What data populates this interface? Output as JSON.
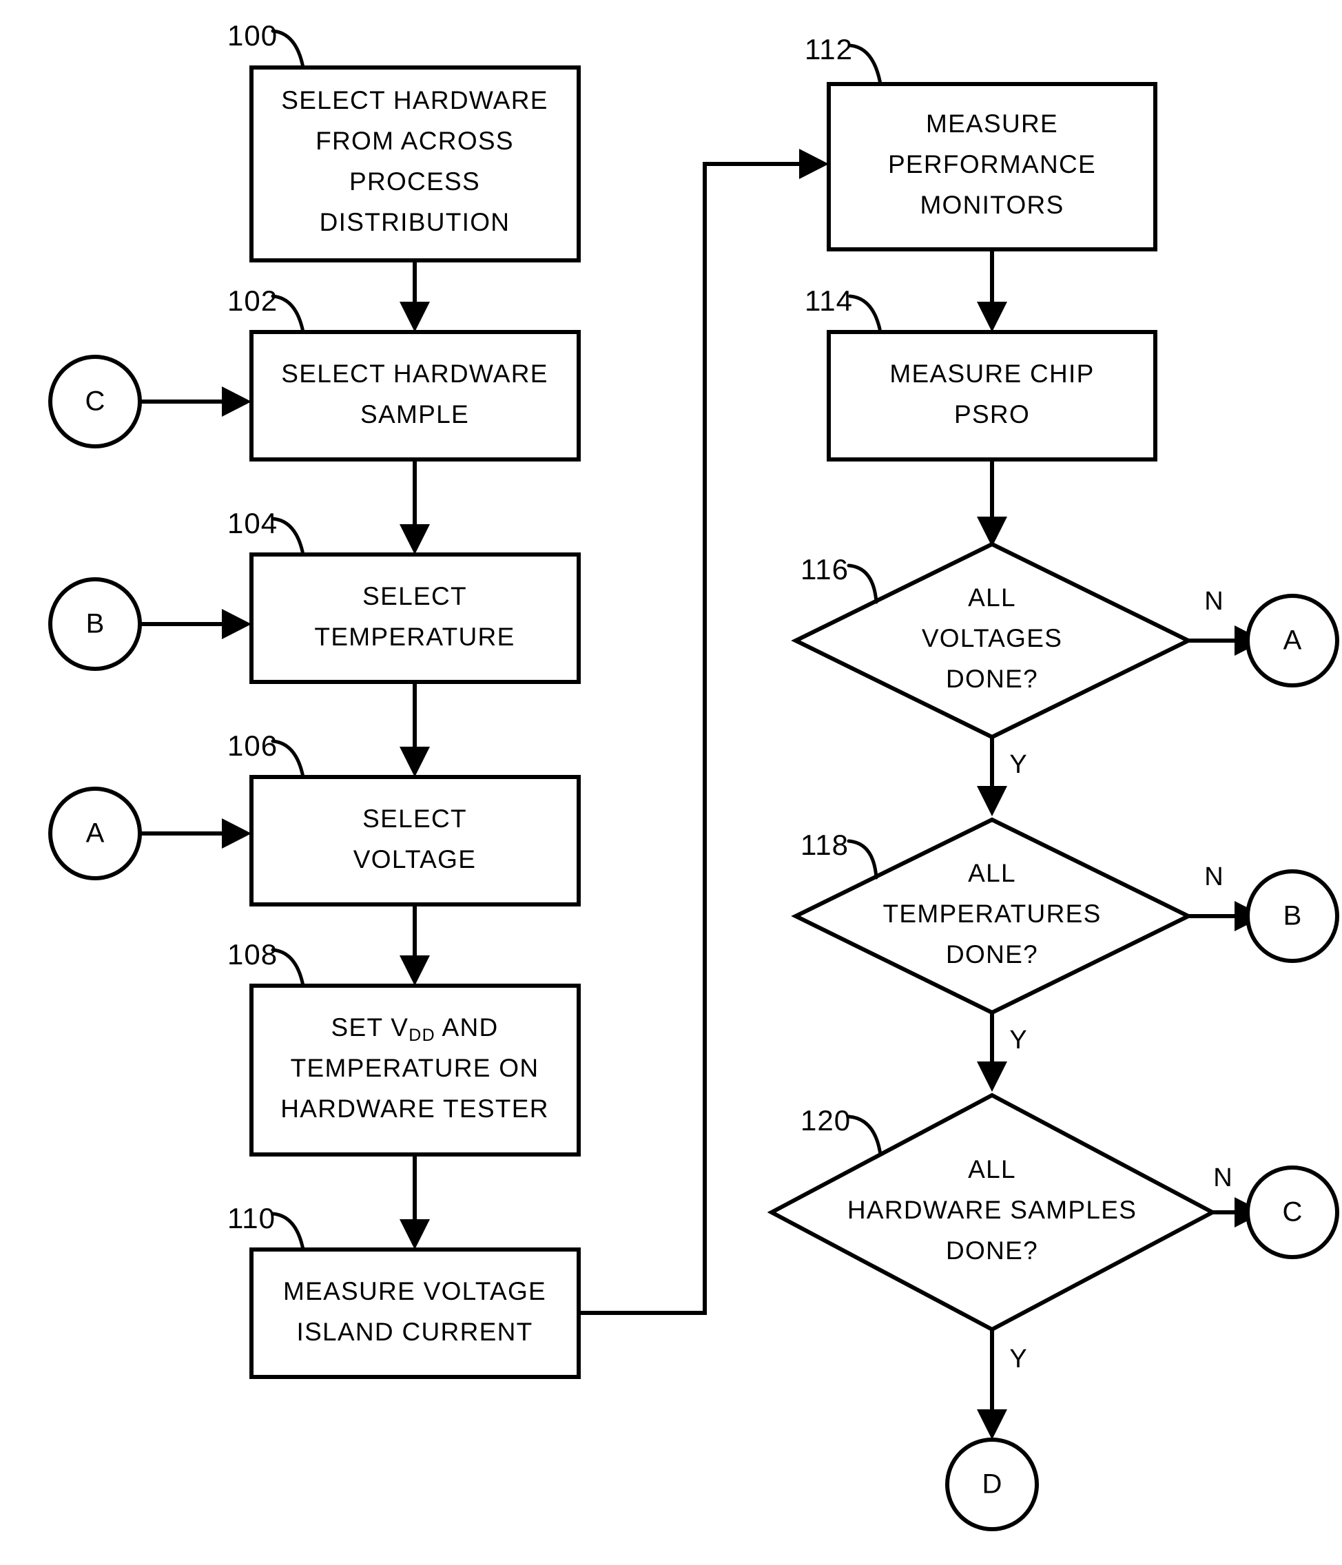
{
  "diagram": {
    "title": "Hardware characterization flowchart",
    "stroke_color": "#000000",
    "background_color": "#ffffff"
  },
  "process_boxes": [
    {
      "ref": "100",
      "name": "select-hardware-from-process-distribution",
      "lines": [
        "SELECT HARDWARE",
        "FROM ACROSS",
        "PROCESS",
        "DISTRIBUTION"
      ]
    },
    {
      "ref": "102",
      "name": "select-hardware-sample",
      "lines": [
        "SELECT HARDWARE",
        "SAMPLE"
      ]
    },
    {
      "ref": "104",
      "name": "select-temperature",
      "lines": [
        "SELECT",
        "TEMPERATURE"
      ]
    },
    {
      "ref": "106",
      "name": "select-voltage",
      "lines": [
        "SELECT",
        "VOLTAGE"
      ]
    },
    {
      "ref": "108",
      "name": "set-vdd-and-temperature",
      "lines": [
        "SET VDD AND",
        "TEMPERATURE ON",
        "HARDWARE TESTER"
      ],
      "line1_prefix": "SET V",
      "line1_sub": "DD",
      "line1_suffix": " AND"
    },
    {
      "ref": "110",
      "name": "measure-voltage-island-current",
      "lines": [
        "MEASURE VOLTAGE",
        "ISLAND CURRENT"
      ]
    },
    {
      "ref": "112",
      "name": "measure-performance-monitors",
      "lines": [
        "MEASURE",
        "PERFORMANCE",
        "MONITORS"
      ]
    },
    {
      "ref": "114",
      "name": "measure-chip-psro",
      "lines": [
        "MEASURE CHIP",
        "PSRO"
      ]
    }
  ],
  "decisions": [
    {
      "ref": "116",
      "name": "all-voltages-done",
      "lines": [
        "ALL",
        "VOLTAGES",
        "DONE?"
      ],
      "yes_label": "Y",
      "no_label": "N",
      "no_target": "A"
    },
    {
      "ref": "118",
      "name": "all-temperatures-done",
      "lines": [
        "ALL",
        "TEMPERATURES",
        "DONE?"
      ],
      "yes_label": "Y",
      "no_label": "N",
      "no_target": "B"
    },
    {
      "ref": "120",
      "name": "all-hardware-samples-done",
      "lines": [
        "ALL",
        "HARDWARE SAMPLES",
        "DONE?"
      ],
      "yes_label": "Y",
      "no_label": "N",
      "no_target": "C"
    }
  ],
  "connectors": [
    {
      "name": "connector-c-in",
      "label": "C",
      "side": "left",
      "target_ref": "102"
    },
    {
      "name": "connector-b-in",
      "label": "B",
      "side": "left",
      "target_ref": "104"
    },
    {
      "name": "connector-a-in",
      "label": "A",
      "side": "left",
      "target_ref": "106"
    },
    {
      "name": "connector-a-out",
      "label": "A",
      "side": "right",
      "source_ref": "116"
    },
    {
      "name": "connector-b-out",
      "label": "B",
      "side": "right",
      "source_ref": "118"
    },
    {
      "name": "connector-c-out",
      "label": "C",
      "side": "right",
      "source_ref": "120"
    },
    {
      "name": "connector-d-out",
      "label": "D",
      "side": "bottom",
      "source_ref": "120"
    }
  ]
}
